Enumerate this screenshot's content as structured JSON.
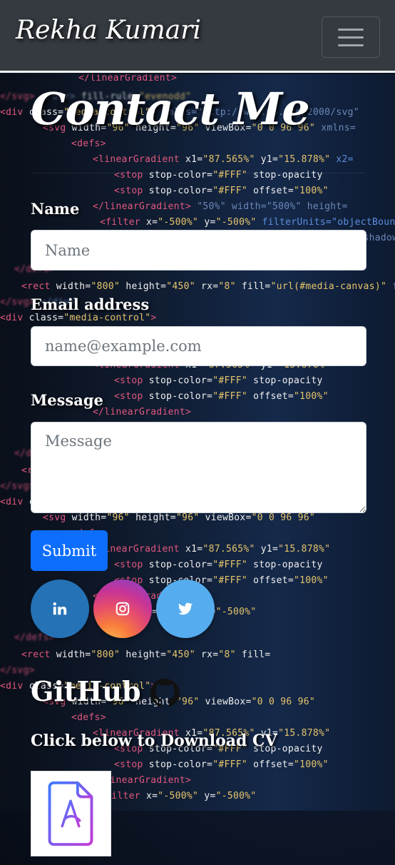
{
  "navbar": {
    "brand": "Rekha Kumari"
  },
  "page": {
    "title": "Contact Me"
  },
  "form": {
    "name_label": "Name",
    "name_placeholder": "Name",
    "email_label": "Email address",
    "email_placeholder": "name@example.com",
    "message_label": "Message",
    "message_placeholder": "Message",
    "submit_label": "Submit"
  },
  "social": {
    "icons": [
      "linkedin-icon",
      "instagram-icon",
      "twitter-icon"
    ],
    "colors": {
      "linkedin": "#2572b6",
      "twitter": "#55acee",
      "instagram": "gradient"
    }
  },
  "github": {
    "title": "GitHub",
    "icon": "github-icon"
  },
  "cv": {
    "text": "Click below to Download CV",
    "icon": "pdf-file-icon"
  },
  "colors": {
    "navbar": "#343a40",
    "submit": "#0d6efd"
  }
}
